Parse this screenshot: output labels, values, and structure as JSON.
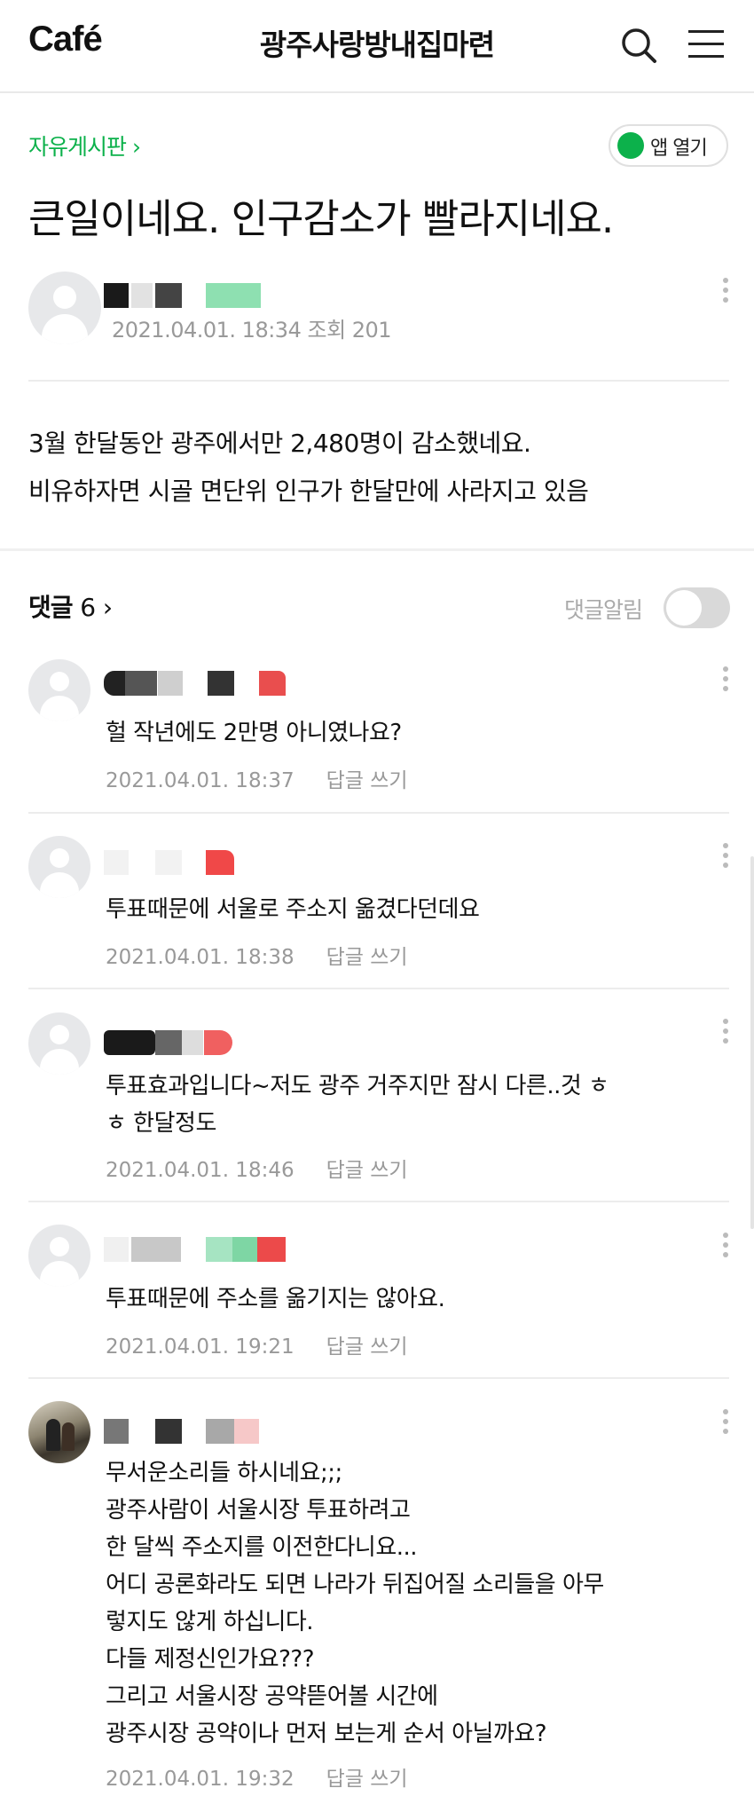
{
  "header": {
    "logo": "Café",
    "cafe_name": "광주사랑방내집마련"
  },
  "post": {
    "board": "자유게시판 ›",
    "app_button": "앱 열기",
    "title": "큰일이네요. 인구감소가 빨라지네요.",
    "date": "2021.04.01. 18:34",
    "views_label": "조회 201",
    "body": [
      "3월 한달동안 광주에서만 2,480명이 감소했네요.",
      "비유하자면 시골 면단위 인구가 한달만에 사라지고 있음"
    ]
  },
  "comments_section": {
    "label": "댓글",
    "count": "6",
    "chevron": "›",
    "notify_label": "댓글알림",
    "notify_on": false,
    "reply_label": "답글 쓰기"
  },
  "comments": [
    {
      "text": [
        "헐 작년에도 2만명 아니였나요?"
      ],
      "date": "2021.04.01. 18:37"
    },
    {
      "text": [
        "투표때문에 서울로 주소지 옮겼다던데요"
      ],
      "date": "2021.04.01. 18:38"
    },
    {
      "text": [
        "투표효과입니다~저도 광주 거주지만 잠시 다른..것 ㅎ",
        "ㅎ 한달정도"
      ],
      "date": "2021.04.01. 18:46"
    },
    {
      "text": [
        "투표때문에 주소를 옮기지는 않아요."
      ],
      "date": "2021.04.01. 19:21"
    },
    {
      "text": [
        "무서운소리들 하시네요;;;",
        "광주사람이 서울시장 투표하려고",
        "한 달씩 주소지를 이전한다니요...",
        "어디 공론화라도 되면 나라가 뒤집어질 소리들을 아무",
        "렇지도 않게 하십니다.",
        "다들 제정신인가요???",
        "그리고 서울시장 공약뜯어볼 시간에",
        "광주시장 공약이나 먼저 보는게 순서 아닐까요?"
      ],
      "date": "2021.04.01. 19:32"
    }
  ],
  "colors": {
    "accent_green": "#0cb14b",
    "meta_gray": "#999999",
    "divider": "#ececec"
  },
  "icons": [
    "search-icon",
    "menu-icon",
    "more-vertical-icon",
    "chevron-right-icon",
    "default-avatar-icon"
  ]
}
